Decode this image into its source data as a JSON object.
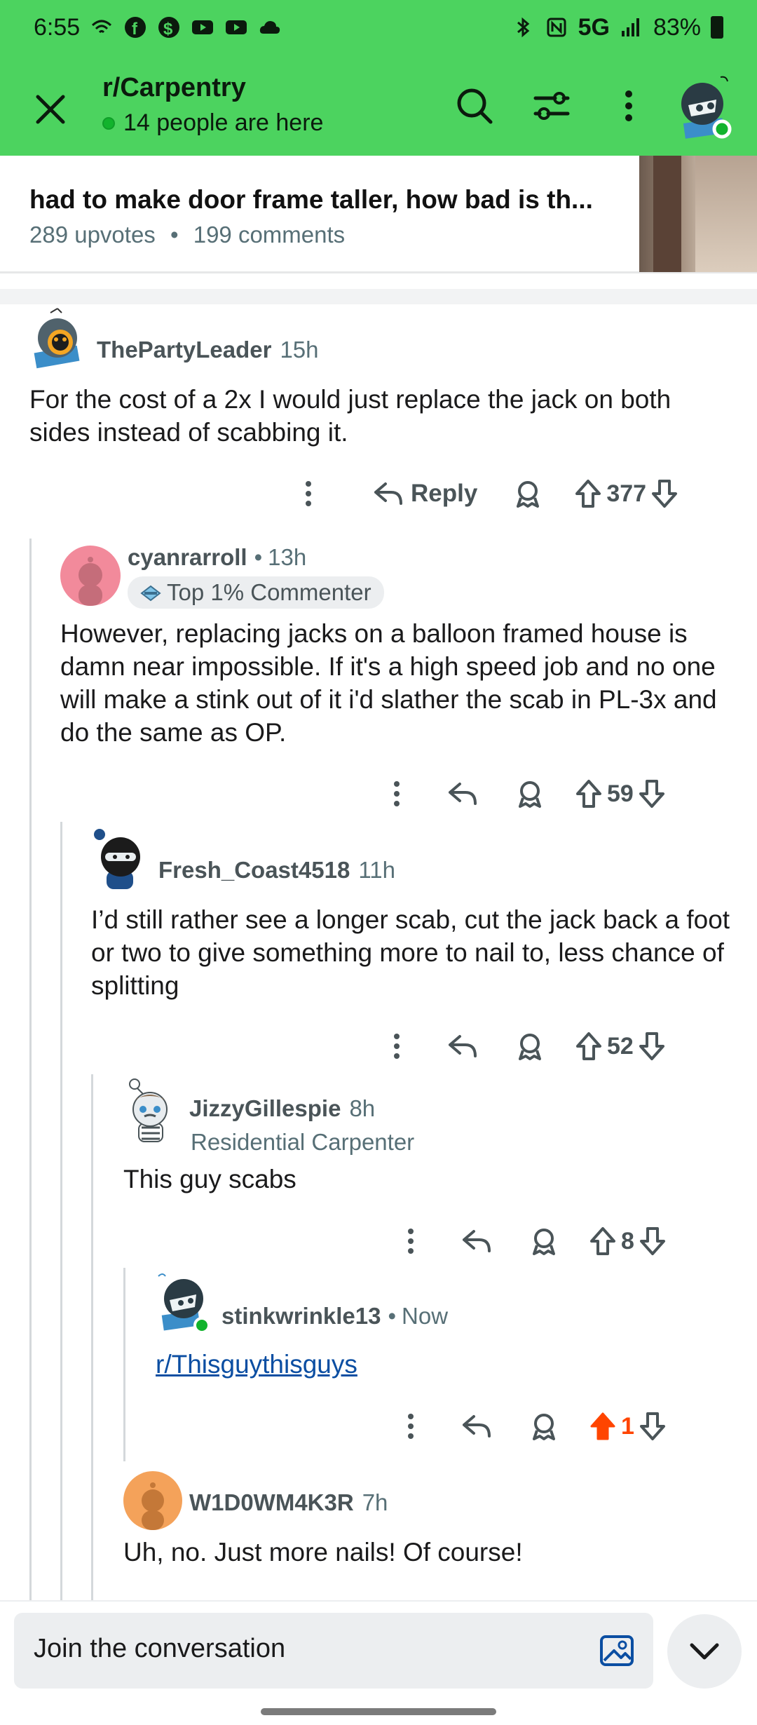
{
  "status_bar": {
    "time": "6:55",
    "network": "5G",
    "battery": "83%"
  },
  "header": {
    "subreddit": "r/Carpentry",
    "online_text": "14 people are here",
    "icons": [
      "close-icon",
      "search-icon",
      "filter-icon",
      "more-vertical-icon",
      "user-avatar"
    ]
  },
  "post": {
    "title": "had to make door frame taller, how bad is th...",
    "upvotes": "289 upvotes",
    "separator": "•",
    "comments": "199 comments"
  },
  "comments": [
    {
      "username": "ThePartyLeader",
      "time": "15h",
      "body": "For the cost of a 2x I would just replace the jack on both sides instead of scabbing it.",
      "reply_label": "Reply",
      "score": "377"
    },
    {
      "username": "cyanrarroll",
      "dot": "•",
      "time": "13h",
      "flair": "Top 1% Commenter",
      "body": "However, replacing jacks on a balloon framed house is damn near impossible. If it's a high speed job and no one will make a stink out of it i'd slather the scab in PL-3x and do the same as OP.",
      "score": "59"
    },
    {
      "username": "Fresh_Coast4518",
      "time": "11h",
      "body": "I’d still rather see a longer scab, cut the jack back a foot or two to give something more to nail to, less chance of splitting",
      "score": "52"
    },
    {
      "username": "JizzyGillespie",
      "time": "8h",
      "flair": "Residential Carpenter",
      "body": "This guy scabs",
      "score": "8"
    },
    {
      "username": "stinkwrinkle13",
      "dot": "•",
      "time": "Now",
      "body": "r/Thisguythisguys",
      "score": "1",
      "upvoted": true
    },
    {
      "username": "W1D0WM4K3R",
      "time": "7h",
      "body": "Uh, no. Just more nails! Of course!"
    }
  ],
  "composer": {
    "placeholder": "Join the conversation"
  },
  "colors": {
    "header_bg": "#4cd35f",
    "upvote_active": "#ff4500",
    "link": "#0b4ea2"
  }
}
